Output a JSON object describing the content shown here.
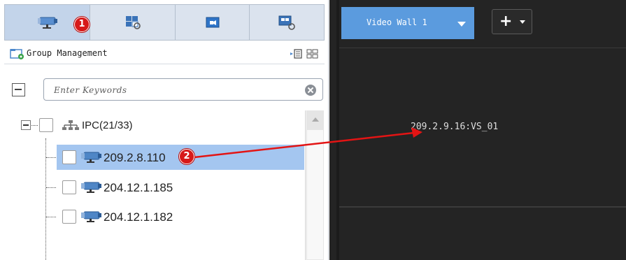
{
  "left_panel": {
    "tabs": [
      {
        "name": "camera-tab",
        "icon": "camera-icon",
        "active": true
      },
      {
        "name": "layout-tab",
        "icon": "layout-refresh-icon",
        "active": false
      },
      {
        "name": "view-tab",
        "icon": "video-window-icon",
        "active": false
      },
      {
        "name": "wall-tab",
        "icon": "screen-refresh-icon",
        "active": false
      }
    ],
    "badge_1": "1",
    "group_title": "Group Management",
    "search_placeholder": "Enter Keywords",
    "tree": {
      "root_label": "IPC(21/33)",
      "items": [
        {
          "label": "209.2.8.110",
          "selected": true
        },
        {
          "label": "204.12.1.185",
          "selected": false
        },
        {
          "label": "204.12.1.182",
          "selected": false
        }
      ]
    },
    "badge_2": "2"
  },
  "right_panel": {
    "wall_title": "Video Wall 1",
    "add_label": "+",
    "screen_label": "209.2.9.16:VS_01"
  },
  "colors": {
    "tab_bar": "#dbe3ee",
    "selection": "#a4c6f0",
    "wall_tab": "#5b9bde",
    "wall_bg": "#242424",
    "annotation_red": "#e31414"
  }
}
